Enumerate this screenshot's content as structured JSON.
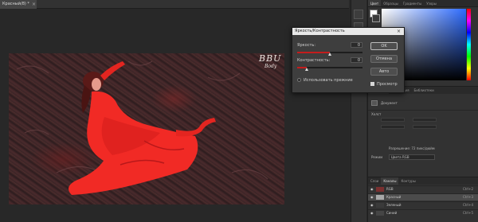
{
  "document": {
    "tab_title": "Красный/8) *",
    "close_glyph": "×"
  },
  "photo": {
    "watermark_main": "BBU",
    "watermark_sub": "Body"
  },
  "panel_tabs": [
    "Цвет",
    "Образцы",
    "Градиенты",
    "Узоры"
  ],
  "properties": {
    "tabs": [
      "Свойства",
      "Коррекция",
      "Библиотеки"
    ],
    "doc_label": "Документ",
    "canvas_label": "Холст",
    "resolution_text": "Разрешение: 72 пикс/дюйм",
    "mode_label": "Режим",
    "mode_value": "Цвета RGB"
  },
  "channels": {
    "tabs": [
      "Слои",
      "Каналы",
      "Контуры"
    ],
    "rows": [
      {
        "name": "RGB",
        "shortcut": "Ctrl+2",
        "thumb": "#7a3030",
        "selected": false
      },
      {
        "name": "Красный",
        "shortcut": "Ctrl+3",
        "thumb": "#a8a8a8",
        "selected": true
      },
      {
        "name": "Зеленый",
        "shortcut": "Ctrl+4",
        "thumb": "#3a3a3a",
        "selected": false
      },
      {
        "name": "Синий",
        "shortcut": "Ctrl+5",
        "thumb": "#454545",
        "selected": false
      }
    ]
  },
  "dialog": {
    "title": "Яркость/Контрастность",
    "close_glyph": "×",
    "brightness_label": "Яркость:",
    "brightness_value": "0",
    "contrast_label": "Контрастность:",
    "contrast_value": "0",
    "legacy_label": "Использовать прежние",
    "ok_label": "OK",
    "cancel_label": "Отмена",
    "auto_label": "Авто",
    "preview_label": "Просмотр",
    "preview_checked": true,
    "brightness_level": 0.5,
    "contrast_level": 0.15
  },
  "colors": {
    "dress": "#f12a25",
    "accent_red": "#c41c1c"
  }
}
